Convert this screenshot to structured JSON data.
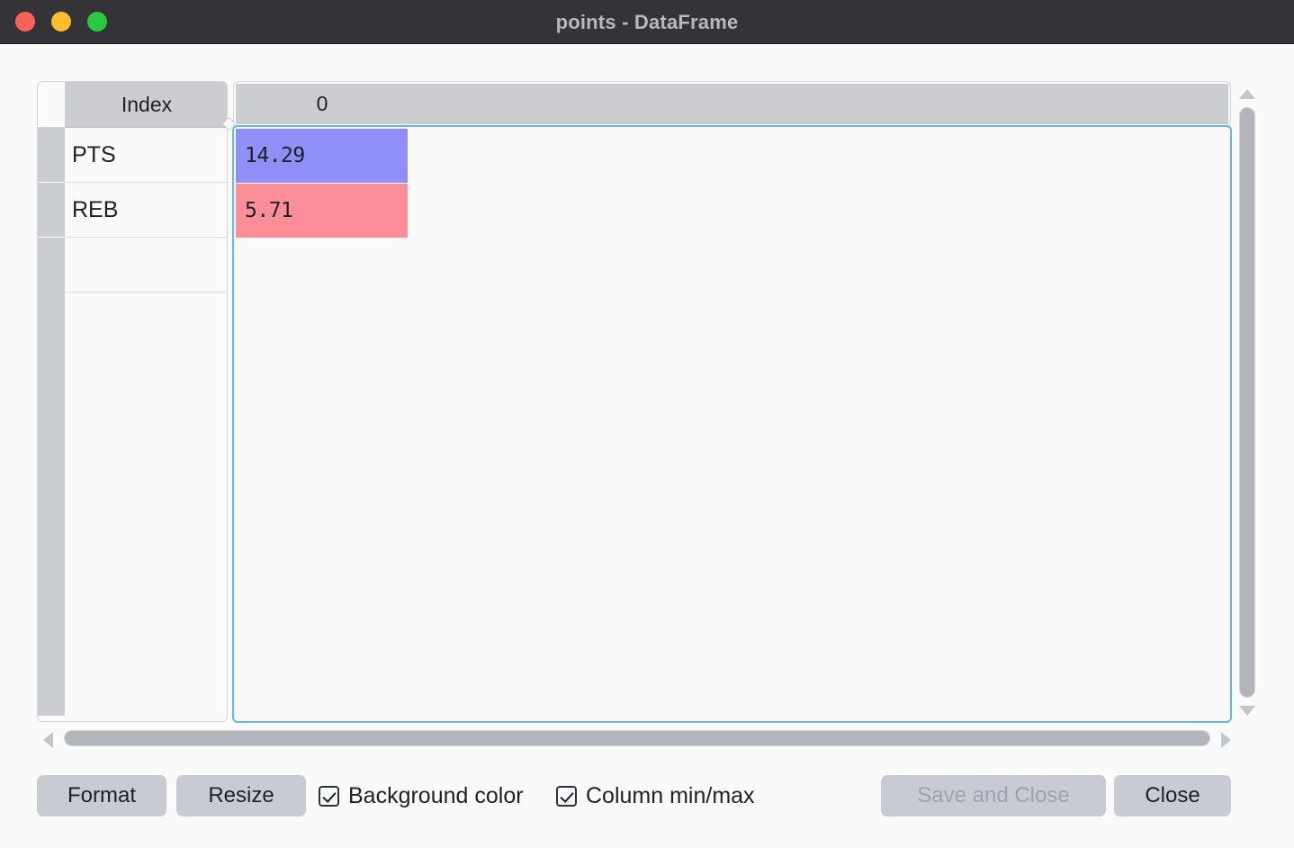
{
  "window": {
    "title": "points - DataFrame",
    "traffic_lights": [
      {
        "name": "close-window-button",
        "color": "#ff6159"
      },
      {
        "name": "minimize-window-button",
        "color": "#ffbd2e"
      },
      {
        "name": "maximize-window-button",
        "color": "#2bc840"
      }
    ]
  },
  "table": {
    "index_header": "Index",
    "column_headers": [
      "0"
    ],
    "rows": [
      {
        "index": "PTS",
        "value": "14.29",
        "bg": "#8f8ff7"
      },
      {
        "index": "REB",
        "value": "5.71",
        "bg": "#fb8e97"
      }
    ]
  },
  "scrollbars": {
    "vertical": {
      "up_arrow": "scroll-up-arrow",
      "down_arrow": "scroll-down-arrow"
    },
    "horizontal": {
      "left_arrow": "scroll-left-arrow",
      "right_arrow": "scroll-right-arrow"
    }
  },
  "toolbar": {
    "format_label": "Format",
    "resize_label": "Resize",
    "background_color_label": "Background color",
    "background_color_checked": true,
    "column_minmax_label": "Column min/max",
    "column_minmax_checked": true,
    "save_and_close_label": "Save and Close",
    "save_and_close_enabled": false,
    "close_label": "Close"
  },
  "colors": {
    "titlebar_bg": "#333338",
    "titlebar_text": "#b8b8bd",
    "header_bg": "#cbcdd1",
    "focus_border": "#66b4f0",
    "button_bg": "#c8ccd2",
    "disabled_text": "#9aa3b0",
    "cell_max": "#8f8ff7",
    "cell_min": "#fb8e97"
  }
}
